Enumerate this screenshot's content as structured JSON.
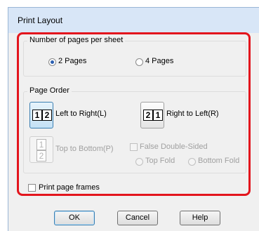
{
  "dialog": {
    "title": "Print Layout"
  },
  "pages_per_sheet": {
    "legend": "Number of pages per sheet",
    "options": [
      {
        "label": "2 Pages",
        "checked": true
      },
      {
        "label": "4 Pages",
        "checked": false
      }
    ]
  },
  "page_order": {
    "legend": "Page Order",
    "left_to_right": {
      "label": "Left to Right(L)",
      "pages": [
        "1",
        "2"
      ]
    },
    "right_to_left": {
      "label": "Right to Left(R)",
      "pages": [
        "2",
        "1"
      ]
    },
    "top_to_bottom": {
      "label": "Top to Bottom(P)",
      "pages": [
        "1",
        "2"
      ]
    },
    "false_double_sided": {
      "label": "False Double-Sided",
      "checked": false
    },
    "fold": [
      {
        "label": "Top Fold",
        "checked": false
      },
      {
        "label": "Bottom Fold",
        "checked": false
      }
    ]
  },
  "print_page_frames": {
    "label": "Print page frames",
    "checked": false
  },
  "buttons": {
    "ok": "OK",
    "cancel": "Cancel",
    "help": "Help"
  },
  "colors": {
    "highlight": "#e3151d",
    "titlebar": "#d8e6f7",
    "accent": "#2b5fb0"
  }
}
